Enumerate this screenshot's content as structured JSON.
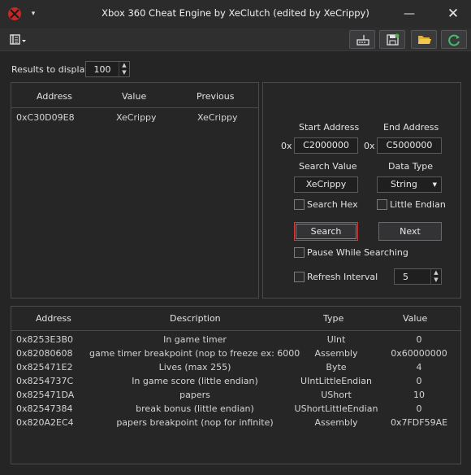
{
  "window": {
    "title": "Xbox 360 Cheat Engine by XeClutch (edited by XeCrippy)",
    "minimize_glyph": "—",
    "close_glyph": "✕",
    "system_menu_glyph": "▾",
    "app_icon": "xbox-icon",
    "accent_color": "#d63a3a"
  },
  "toolbar": {
    "menu_icon": "list-menu-icon",
    "buttons": [
      "network-icon",
      "save-icon",
      "open-folder-icon",
      "refresh-icon"
    ]
  },
  "results": {
    "label": "Results to display",
    "count": "100",
    "columns": [
      "Address",
      "Value",
      "Previous"
    ],
    "rows": [
      {
        "address": "0xC30D09E8",
        "value": "XeCrippy",
        "previous": "XeCrippy"
      }
    ]
  },
  "search": {
    "start_address_label": "Start Address",
    "end_address_label": "End Address",
    "hex_prefix": "0x",
    "start_address": "C2000000",
    "end_address": "C5000000",
    "search_value_label": "Search Value",
    "data_type_label": "Data Type",
    "search_value": "XeCrippy",
    "data_type": "String",
    "search_hex_label": "Search Hex",
    "little_endian_label": "Little Endian",
    "search_button": "Search",
    "next_button": "Next",
    "pause_label": "Pause While Searching",
    "refresh_label": "Refresh Interval",
    "refresh_value": "5"
  },
  "cheats": {
    "columns": [
      "Address",
      "Description",
      "Type",
      "Value"
    ],
    "rows": [
      {
        "address": "0x8253E3B0",
        "description": "In game timer",
        "type": "UInt",
        "value": "0"
      },
      {
        "address": "0x82080608",
        "description": "game timer breakpoint (nop to freeze ex: 6000...",
        "type": "Assembly",
        "value": "0x60000000"
      },
      {
        "address": "0x825471E2",
        "description": "Lives (max 255)",
        "type": "Byte",
        "value": "4"
      },
      {
        "address": "0x8254737C",
        "description": "In game score (little endian)",
        "type": "UIntLittleEndian",
        "value": "0"
      },
      {
        "address": "0x825471DA",
        "description": "papers",
        "type": "UShort",
        "value": "10"
      },
      {
        "address": "0x82547384",
        "description": "break bonus (little endian)",
        "type": "UShortLittleEndian",
        "value": "0"
      },
      {
        "address": "0x820A2EC4",
        "description": "papers breakpoint (nop for infinite)",
        "type": "Assembly",
        "value": "0x7FDF59AE"
      }
    ]
  }
}
